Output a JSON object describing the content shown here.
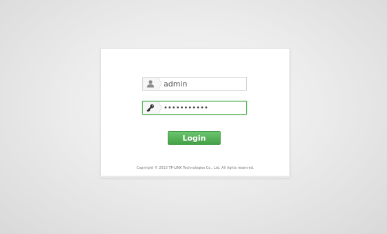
{
  "login": {
    "username_value": "admin",
    "password_value": "•••••••••••",
    "login_label": "Login",
    "copyright": "Copyright © 2015 TP-LINK Technologies Co., Ltd. All rights reserved."
  },
  "icons": {
    "username": "user-icon",
    "password": "key-icon"
  },
  "colors": {
    "accent_green": "#43a146",
    "focus_border": "#4caf50",
    "background": "#e6e6e6"
  }
}
